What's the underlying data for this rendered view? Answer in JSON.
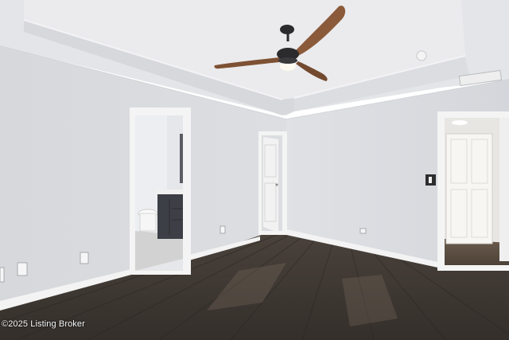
{
  "photo": {
    "watermark": "©2025 Listing Broker",
    "palette": {
      "wall": "#d9dbdf",
      "wall_shadow": "#c9ccd2",
      "ceiling": "#e8e9ec",
      "trim": "#f5f5f5",
      "floor": "#3b3631",
      "floor_light": "#5a5048",
      "fan_wood": "#8b5a3a",
      "fan_dark": "#2b2b2d",
      "vanity": "#3c3f45"
    }
  }
}
